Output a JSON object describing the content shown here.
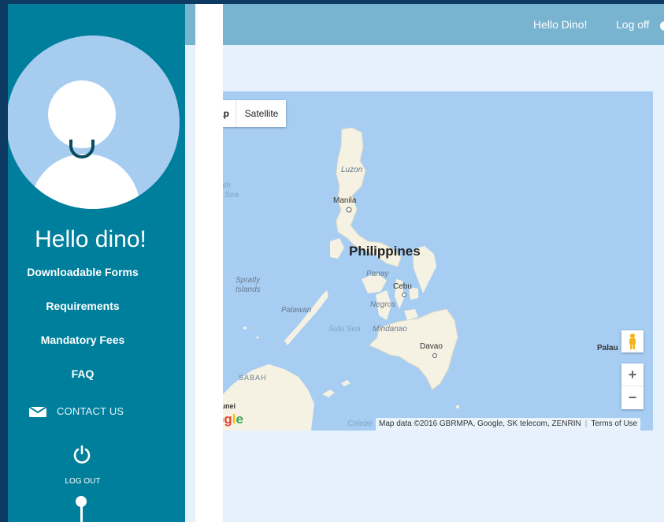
{
  "sidebar": {
    "greeting": "Hello dino!",
    "nav": [
      "Downloadable Forms",
      "Requirements",
      "Mandatory Fees",
      "FAQ"
    ],
    "contact": "CONTACT US",
    "logout": "LOG OUT"
  },
  "topbar": {
    "hello": "Hello Dino!",
    "logoff": "Log off"
  },
  "map": {
    "map_type_map": "ap",
    "map_type_satellite": "Satellite",
    "labels": {
      "luzon": "Luzon",
      "manila": "Manila",
      "philippines": "Philippines",
      "panay": "Panay",
      "cebu": "Cebu",
      "negros": "Negros",
      "palawan": "Palawan",
      "sulu_sea": "Sulu Sea",
      "mindanao": "Mindanao",
      "davao": "Davao",
      "spratly": "Spratly",
      "islands": "Islands",
      "south": "uth",
      "sea": "Sea",
      "sabah": "SABAH",
      "brunei": "runei",
      "palau": "Palau",
      "celebes": "Celebe"
    },
    "attribution": "Map data ©2016 GBRMPA, Google, SK telecom, ZENRIN",
    "terms": "Terms of Use",
    "logo": "ogle",
    "zoom_in": "+",
    "zoom_out": "−"
  },
  "colors": {
    "sidebar": "#007f9c",
    "topbar": "#78b3cf",
    "content_bg": "#e6f1fd",
    "water": "#a7cdf2",
    "land": "#f5f2e3"
  },
  "icons": [
    "mail-icon",
    "power-icon",
    "pegman-icon"
  ]
}
